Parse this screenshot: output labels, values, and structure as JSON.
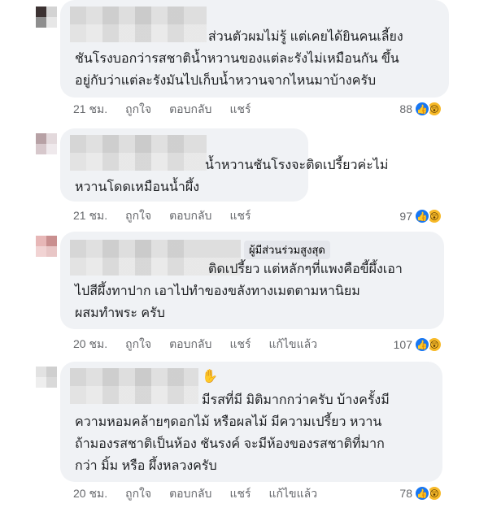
{
  "comments": [
    {
      "avatar_colors": [
        "#3c3232",
        "#d3d3d3",
        "#8e8e8e",
        "#e7e7e7"
      ],
      "lines": [
        "ส่วนตัวผมไม่รู้ แต่เคยได้ยินคนเลี้ยง",
        "ชันโรงบอกว่ารสชาติน้ำหวานของแต่ละรังไม่เหมือนกัน ขึ้น",
        "อยู่กับว่าแต่ละรังมันไปเก็บน้ำหวานจากไหนมาบ้างครับ"
      ],
      "time": "21 ชม.",
      "like": "ถูกใจ",
      "reply": "ตอบกลับ",
      "share": "แชร์",
      "count": "88"
    },
    {
      "avatar_colors": [
        "#b7a1a5",
        "#e3d9dc",
        "#d7c8cc",
        "#efe9ec"
      ],
      "lines": [
        "น้ำหวานชันโรงจะติดเปรี้ยวค่ะไม่",
        "หวานโดดเหมือนน้ำผึ้ง"
      ],
      "time": "21 ชม.",
      "like": "ถูกใจ",
      "reply": "ตอบกลับ",
      "share": "แชร์",
      "count": "97"
    },
    {
      "avatar_colors": [
        "#e7b7b7",
        "#c98f8f",
        "#f1d3d3",
        "#e8c6c6"
      ],
      "badge": "ผู้มีส่วนร่วมสูงสุด",
      "lines": [
        "ติดเปรี้ยว แต่หลักๆที่แพงคือขี้ผึ้งเอา",
        "ไปสีผึ้งทาปาก เอาไปทำของขลังทางเมตตามหานิยม",
        "ผสมทำพระ ครับ"
      ],
      "time": "20 ชม.",
      "like": "ถูกใจ",
      "reply": "ตอบกลับ",
      "share": "แชร์",
      "edited": "แก้ไขแล้ว",
      "count": "107"
    },
    {
      "avatar_colors": [
        "#e2e2e2",
        "#cfcfcf",
        "#eeeeee",
        "#d9d9d9"
      ],
      "lines": [
        "มีรสที่มี มิติมากกว่าครับ บ้างครั้งมี",
        "ความหอมคล้ายๆดอกไม้ หรือผลไม้ มีความเปรี้ยว หวาน",
        "ถ้ามองรสชาติเป็นห้อง ชันรงค์ จะมีห้องของรสชาติที่มาก",
        "กว่า มิ้ม หรือ ผึ้งหลวงครับ"
      ],
      "time": "20 ชม.",
      "like": "ถูกใจ",
      "reply": "ตอบกลับ",
      "share": "แชร์",
      "edited": "แก้ไขแล้ว",
      "count": "78"
    }
  ],
  "icons": {
    "like": "like-reaction-icon",
    "wow": "wow-reaction-icon",
    "hand": "raised-hand-icon"
  },
  "colors": {
    "bubble": "#f0f2f5",
    "like_blue": "#1877f2",
    "wow_yellow": "#f7b928",
    "meta_gray": "#65676b"
  }
}
